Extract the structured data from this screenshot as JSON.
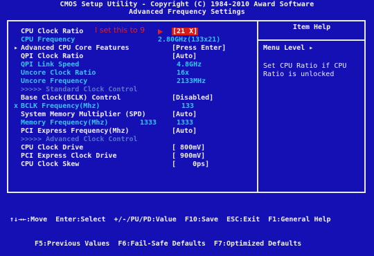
{
  "header": {
    "title_line1": "CMOS Setup Utility - Copyright (C) 1984-2010 Award Software",
    "title_line2": "Advanced Frequency Settings"
  },
  "annotation": "I set this to 9",
  "settings": [
    {
      "marker": "",
      "label": "CPU Clock Ratio",
      "value": "[21 X]"
    },
    {
      "marker": "",
      "label": "CPU Frequency",
      "value": "2.80GHz(133x21)"
    },
    {
      "marker": "▸",
      "label": "Advanced CPU Core Features",
      "value": "[Press Enter]"
    },
    {
      "marker": "",
      "label": "QPI Clock Ratio",
      "value": "[Auto]"
    },
    {
      "marker": "",
      "label": "QPI Link Speed",
      "value": "4.8GHz"
    },
    {
      "marker": "",
      "label": "Uncore Clock Ratio",
      "value": "16x"
    },
    {
      "marker": "",
      "label": "Uncore Frequency",
      "value": "2133MHz"
    },
    {
      "marker": "",
      "label": ">>>>> Standard Clock Control",
      "value": ""
    },
    {
      "marker": "",
      "label": "Base Clock(BCLK) Control",
      "value": "[Disabled]"
    },
    {
      "marker": "x",
      "label": "BCLK Frequency(Mhz)",
      "value": "133"
    },
    {
      "marker": "",
      "label": "System Memory Multiplier (SPD)",
      "value": "[Auto]"
    },
    {
      "marker": "",
      "label": "Memory Frequency(Mhz)",
      "value": "1333",
      "value2": "1333"
    },
    {
      "marker": "",
      "label": "PCI Express Frequency(Mhz)",
      "value": "[Auto]"
    },
    {
      "marker": "",
      "label": ">>>>> Advanced Clock Control",
      "value": ""
    },
    {
      "marker": "",
      "label": "CPU Clock Drive",
      "value": "[ 800mV]"
    },
    {
      "marker": "",
      "label": "PCI Express Clock Drive",
      "value": "[ 900mV]"
    },
    {
      "marker": "",
      "label": "CPU Clock Skew",
      "value": "[    0ps]"
    }
  ],
  "help": {
    "title": "Item Help",
    "menu_level": "Menu Level",
    "menu_level_marker": "▸",
    "text_line1": "Set CPU Ratio if CPU",
    "text_line2": "Ratio is unlocked"
  },
  "footer": {
    "line1": "↑↓→←:Move  Enter:Select  +/-/PU/PD:Value  F10:Save  ESC:Exit  F1:General Help",
    "line2": "F5:Previous Values  F6:Fail-Safe Defaults  F7:Optimized Defaults"
  },
  "colors": {
    "background": "#1410b4",
    "label_white": "#f0f0f0",
    "value_cyan": "#30c8f0",
    "disabled_blue": "#5a74c8",
    "highlight_red": "#d71a1a"
  }
}
